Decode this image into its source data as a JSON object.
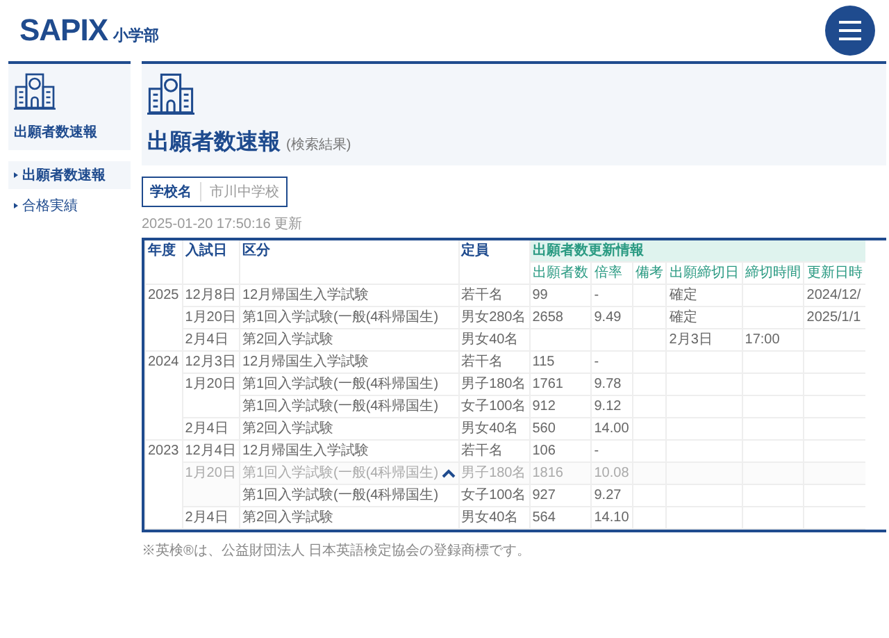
{
  "header": {
    "logo": "SAPIX",
    "logo_sub": "小学部"
  },
  "sidebar": {
    "heading": "出願者数速報",
    "items": [
      {
        "label": "出願者数速報",
        "selected": true
      },
      {
        "label": "合格実績",
        "selected": false
      }
    ]
  },
  "main": {
    "title": "出願者数速報",
    "title_note": "(検索結果)",
    "school_field": {
      "label": "学校名",
      "value": "市川中学校"
    },
    "updated": "2025-01-20 17:50:16 更新",
    "table": {
      "columns": [
        "年度",
        "入試日",
        "区分",
        "定員"
      ],
      "group_heading": "出願者数更新情報",
      "sub_columns": [
        "出願者数",
        "倍率",
        "備考",
        "出願締切日",
        "締切時間",
        "更新日時"
      ],
      "years": [
        {
          "year": "2025",
          "dates": [
            {
              "date": "12月8日",
              "rows": [
                [
                  "12月帰国生入学試験",
                  "若干名",
                  "99",
                  "-",
                  "",
                  "確定",
                  "",
                  "2024/12/"
                ]
              ]
            },
            {
              "date": "1月20日",
              "rows": [
                [
                  "第1回入学試験(一般(4科帰国生)",
                  "男女280名",
                  "2658",
                  "9.49",
                  "",
                  "確定",
                  "",
                  "2025/1/1"
                ]
              ]
            },
            {
              "date": "2月4日",
              "rows": [
                [
                  "第2回入学試験",
                  "男女40名",
                  "",
                  "",
                  "",
                  "2月3日",
                  "17:00",
                  ""
                ]
              ]
            }
          ]
        },
        {
          "year": "2024",
          "dates": [
            {
              "date": "12月3日",
              "rows": [
                [
                  "12月帰国生入学試験",
                  "若干名",
                  "115",
                  "-",
                  "",
                  "",
                  "",
                  ""
                ]
              ]
            },
            {
              "date": "1月20日",
              "rows": [
                [
                  "第1回入学試験(一般(4科帰国生)",
                  "男子180名",
                  "1761",
                  "9.78",
                  "",
                  "",
                  "",
                  ""
                ],
                [
                  "第1回入学試験(一般(4科帰国生)",
                  "女子100名",
                  "912",
                  "9.12",
                  "",
                  "",
                  "",
                  ""
                ]
              ]
            },
            {
              "date": "2月4日",
              "rows": [
                [
                  "第2回入学試験",
                  "男女40名",
                  "560",
                  "14.00",
                  "",
                  "",
                  "",
                  ""
                ]
              ]
            }
          ]
        },
        {
          "year": "2023",
          "dates": [
            {
              "date": "12月4日",
              "rows": [
                [
                  "12月帰国生入学試験",
                  "若干名",
                  "106",
                  "-",
                  "",
                  "",
                  "",
                  ""
                ]
              ]
            },
            {
              "date": "1月20日",
              "rows": [
                [
                  "第1回入学試験(一般(4科帰国生)",
                  "男子180名",
                  "1816",
                  "10.08",
                  "",
                  "",
                  "",
                  ""
                ],
                [
                  "第1回入学試験(一般(4科帰国生)",
                  "女子100名",
                  "927",
                  "9.27",
                  "",
                  "",
                  "",
                  ""
                ]
              ]
            },
            {
              "date": "2月4日",
              "rows": [
                [
                  "第2回入学試験",
                  "男女40名",
                  "564",
                  "14.10",
                  "",
                  "",
                  "",
                  ""
                ]
              ]
            }
          ]
        }
      ]
    }
  },
  "footnote": "※英検®は、公益財団法人 日本英語検定協会の登録商標です。"
}
